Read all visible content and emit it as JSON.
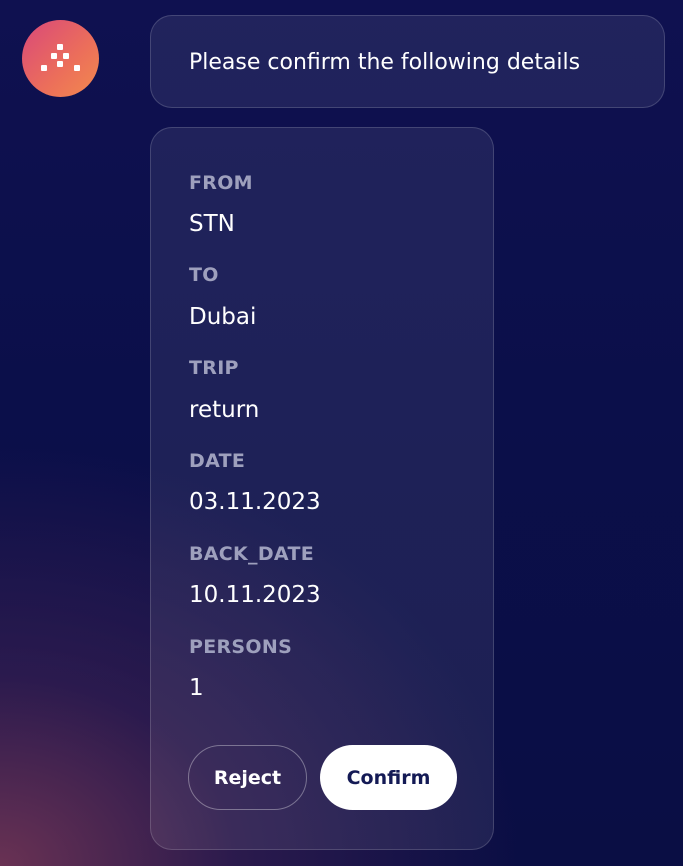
{
  "assistant": {
    "avatar_icon": "dots-logo-icon"
  },
  "message": {
    "text": "Please confirm the following details"
  },
  "details": [
    {
      "label": "FROM",
      "value": "STN"
    },
    {
      "label": "TO",
      "value": "Dubai"
    },
    {
      "label": "TRIP",
      "value": "return"
    },
    {
      "label": "DATE",
      "value": "03.11.2023"
    },
    {
      "label": "BACK_DATE",
      "value": "10.11.2023"
    },
    {
      "label": "PERSONS",
      "value": "1"
    }
  ],
  "actions": {
    "reject_label": "Reject",
    "confirm_label": "Confirm"
  },
  "colors": {
    "avatar_gradient_start": "#d9487a",
    "avatar_gradient_end": "#f28a4e",
    "background": "#0b0f4a",
    "label": "#9ea0bd",
    "confirm_text": "#141a55"
  }
}
